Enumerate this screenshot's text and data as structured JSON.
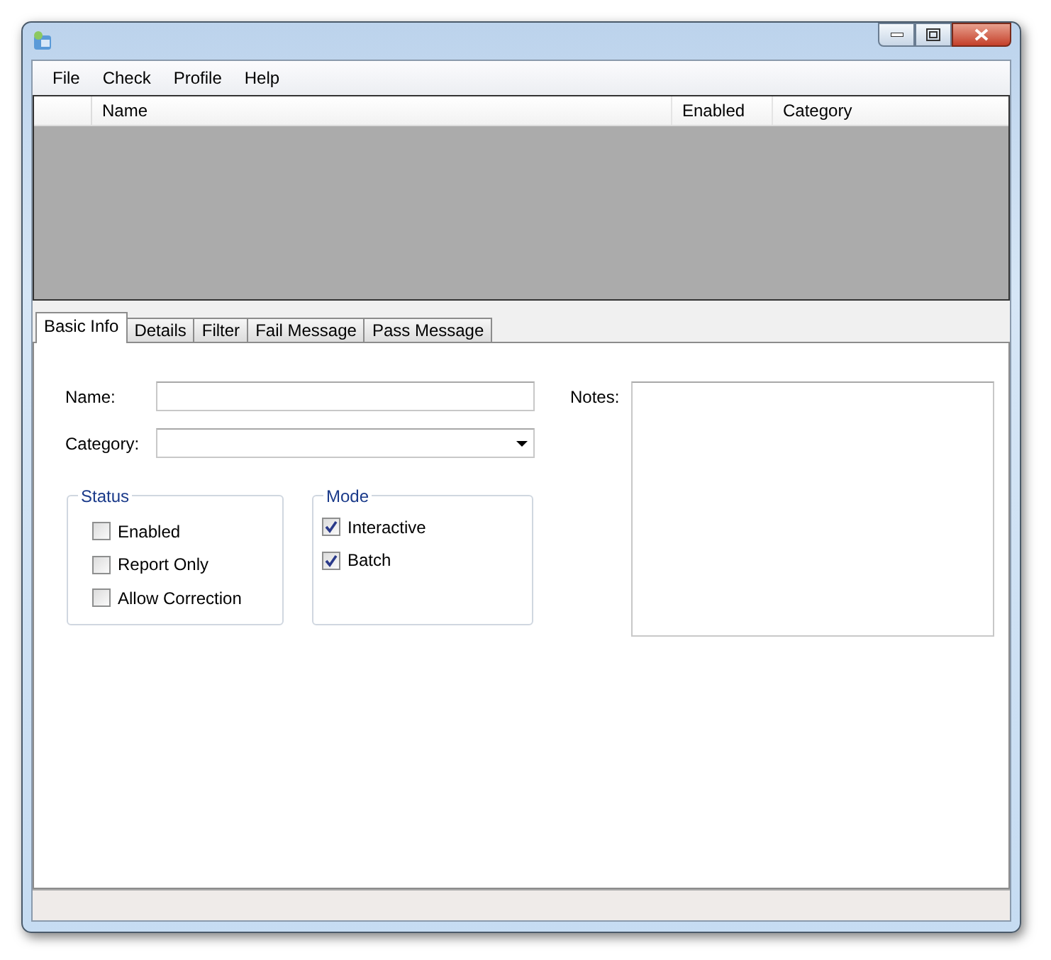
{
  "menu": [
    "File",
    "Check",
    "Profile",
    "Help"
  ],
  "table": {
    "columns": [
      "Name",
      "Enabled",
      "Category"
    ]
  },
  "tabs": [
    {
      "label": "Basic Info",
      "selected": true
    },
    {
      "label": "Details",
      "selected": false
    },
    {
      "label": "Filter",
      "selected": false
    },
    {
      "label": "Fail Message",
      "selected": false
    },
    {
      "label": "Pass Message",
      "selected": false
    }
  ],
  "form": {
    "name_label": "Name:",
    "category_label": "Category:",
    "notes_label": "Notes:"
  },
  "groups": [
    {
      "title": "Status",
      "options": [
        {
          "label": "Enabled",
          "checked": false
        },
        {
          "label": "Report Only",
          "checked": false
        },
        {
          "label": "Allow Correction",
          "checked": false
        }
      ]
    },
    {
      "title": "Mode",
      "options": [
        {
          "label": "Interactive",
          "checked": true
        },
        {
          "label": "Batch",
          "checked": true
        }
      ]
    }
  ]
}
